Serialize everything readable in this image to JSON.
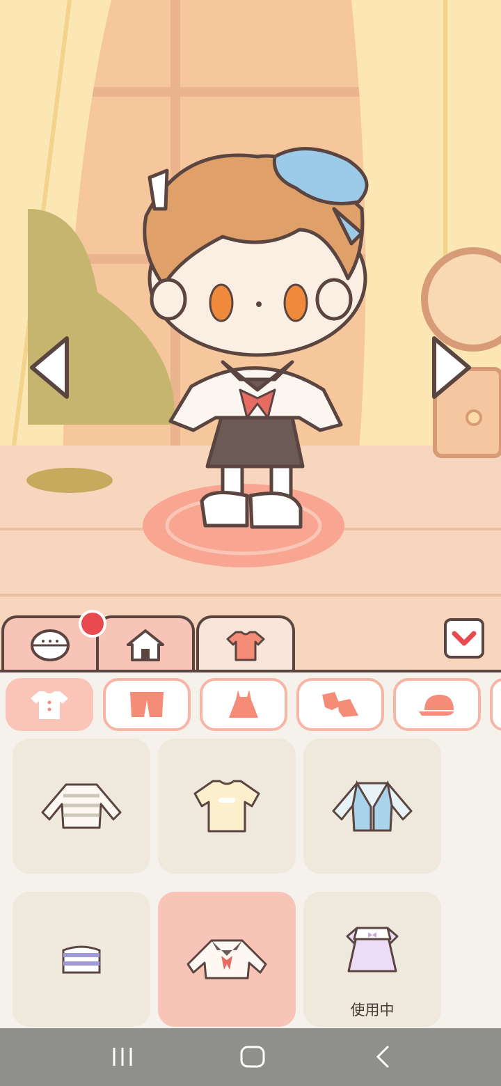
{
  "scene": {
    "character": "chibi-character",
    "left_arrow": "left-triangle-icon",
    "right_arrow": "right-triangle-icon"
  },
  "tabs": [
    {
      "icon": "character-face-icon",
      "active": false
    },
    {
      "icon": "house-icon",
      "active": false,
      "badge": true
    },
    {
      "icon": "shirt-icon",
      "active": true
    }
  ],
  "categories": [
    {
      "icon": "top-icon",
      "selected": true
    },
    {
      "icon": "pants-icon",
      "selected": false
    },
    {
      "icon": "dress-icon",
      "selected": false
    },
    {
      "icon": "shoes-icon",
      "selected": false
    },
    {
      "icon": "hat-icon",
      "selected": false
    }
  ],
  "items": [
    {
      "icon": "striped-long-sleeve-icon",
      "selected": false,
      "status": ""
    },
    {
      "icon": "cream-tshirt-icon",
      "selected": false,
      "status": ""
    },
    {
      "icon": "blue-jacket-icon",
      "selected": false,
      "status": ""
    },
    {
      "icon": "purple-striped-top-icon",
      "selected": false,
      "status": ""
    },
    {
      "icon": "sailor-top-icon",
      "selected": true,
      "status": ""
    },
    {
      "icon": "lilac-dress-icon",
      "selected": false,
      "status": "使用中"
    }
  ],
  "colors": {
    "outline": "#5b4540",
    "active_tab": "#f7e5da",
    "inactive_tab": "#f9c4b8",
    "accent": "#e94a4f",
    "selected_item": "#f9c4b8"
  }
}
